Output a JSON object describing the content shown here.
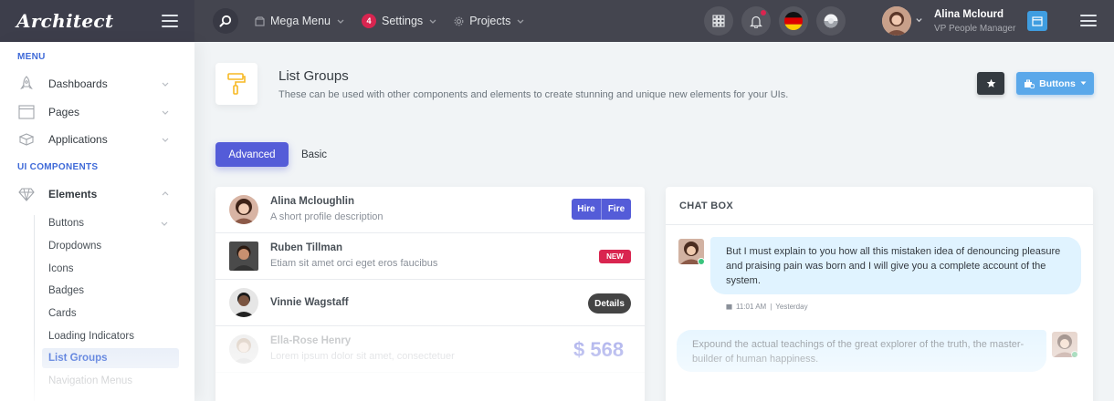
{
  "header": {
    "logo": "Architect",
    "nav": [
      {
        "label": "Mega Menu",
        "icon": "box-icon"
      },
      {
        "label": "Settings",
        "badge": "4"
      },
      {
        "label": "Projects",
        "icon": "gear-icon"
      }
    ],
    "user": {
      "name": "Alina Mclourd",
      "role": "VP People Manager"
    }
  },
  "sidebar": {
    "heading_menu": "MENU",
    "menu_items": [
      {
        "label": "Dashboards",
        "icon": "rocket-icon"
      },
      {
        "label": "Pages",
        "icon": "browser-icon"
      },
      {
        "label": "Applications",
        "icon": "cubes-icon"
      }
    ],
    "heading_components": "UI COMPONENTS",
    "elements_label": "Elements",
    "sub_items": [
      "Buttons",
      "Dropdowns",
      "Icons",
      "Badges",
      "Cards",
      "Loading Indicators",
      "List Groups",
      "Navigation Menus"
    ],
    "active_sub_item": "List Groups"
  },
  "page": {
    "title": "List Groups",
    "subtitle": "These can be used with other components and elements to create stunning and unique new elements for your UIs.",
    "buttons_label": "Buttons"
  },
  "tabs": [
    {
      "label": "Advanced",
      "active": true
    },
    {
      "label": "Basic",
      "active": false
    }
  ],
  "list": [
    {
      "name": "Alina Mcloughlin",
      "desc": "A short profile description",
      "action": {
        "hire": "Hire",
        "fire": "Fire"
      }
    },
    {
      "name": "Ruben Tillman",
      "desc": "Etiam sit amet orci eget eros faucibus",
      "badge": "NEW"
    },
    {
      "name": "Vinnie Wagstaff",
      "desc": "",
      "pill": "Details"
    },
    {
      "name": "Ella-Rose Henry",
      "desc": "Lorem ipsum dolor sit amet, consectetuer",
      "price": "$ 568"
    }
  ],
  "chat": {
    "title": "CHAT BOX",
    "messages": [
      {
        "text": "But I must explain to you how all this mistaken idea of denouncing pleasure and praising pain was born and I will give you a complete account of the system.",
        "time": "11:01 AM",
        "day": "Yesterday"
      },
      {
        "text": "Expound the actual teachings of the great explorer of the truth, the master-builder of human happiness."
      }
    ]
  },
  "colors": {
    "primary": "#545cd8",
    "header_bg": "#44454f",
    "logo_bg": "#3d3e4b",
    "danger": "#d92550",
    "info": "#5aa8ea",
    "chat_bubble": "#e0f3ff",
    "online": "#3ac47d"
  }
}
